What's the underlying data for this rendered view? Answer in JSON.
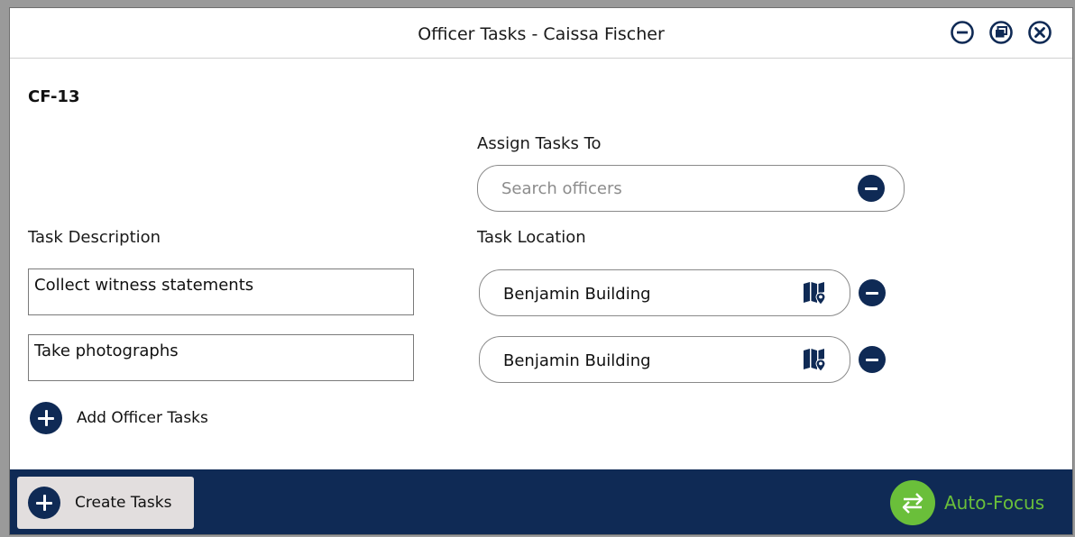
{
  "window": {
    "title": "Officer Tasks - Caissa Fischer",
    "controls": [
      "minimize-icon",
      "restore-icon",
      "close-icon"
    ]
  },
  "case": {
    "id": "CF-13"
  },
  "assign": {
    "label": "Assign Tasks To",
    "placeholder": "Search officers"
  },
  "columns": {
    "description_label": "Task Description",
    "location_label": "Task Location"
  },
  "tasks": [
    {
      "description": "Collect witness statements",
      "location": "Benjamin Building"
    },
    {
      "description": "Take photographs",
      "location": "Benjamin Building"
    }
  ],
  "add_tasks_label": "Add Officer Tasks",
  "footer": {
    "create_label": "Create Tasks",
    "autofocus_label": "Auto-Focus"
  },
  "colors": {
    "navy": "#0f2a55",
    "green": "#6abf3a",
    "create_button_bg": "#e2dede"
  }
}
